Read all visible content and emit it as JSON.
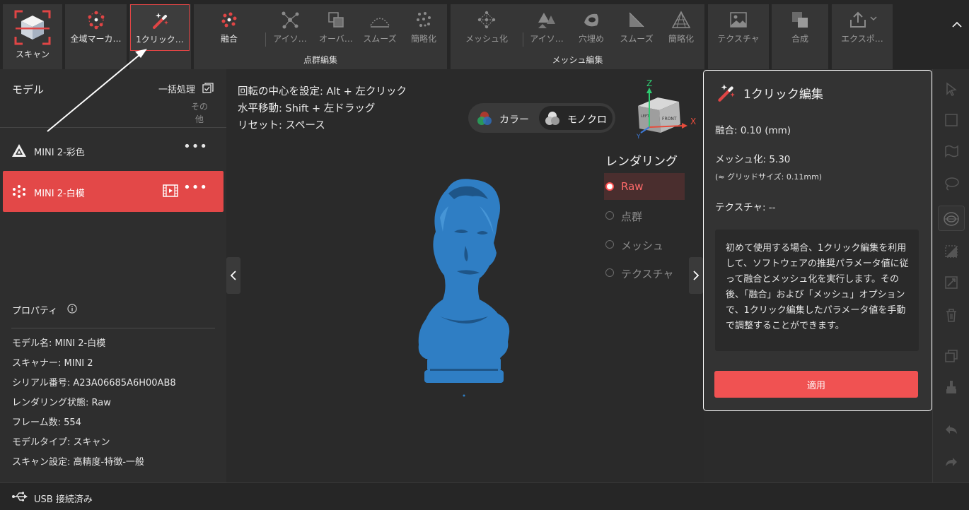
{
  "toolbar": {
    "scan": {
      "label": "スキャン"
    },
    "global_marker": {
      "label": "全域マーカ…"
    },
    "one_click": {
      "label": "1クリック…"
    },
    "point_group": {
      "title": "点群編集",
      "tools": [
        "融合",
        "アイソ…",
        "オーバ…",
        "スムーズ",
        "簡略化"
      ]
    },
    "mesh_group": {
      "title": "メッシュ編集",
      "tools": [
        "メッシュ化",
        "アイソ…",
        "穴埋め",
        "スムーズ",
        "簡略化"
      ]
    },
    "texture": {
      "label": "テクスチャ"
    },
    "merge": {
      "label": "合成"
    },
    "export": {
      "label": "エクスポ…"
    }
  },
  "left_panel": {
    "title": "モデル",
    "batch_label": "一括処理",
    "other_label": "その他",
    "models": [
      {
        "name": "MINI 2-彩色",
        "selected": false
      },
      {
        "name": "MINI 2-白模",
        "selected": true
      }
    ],
    "properties": {
      "title": "プロパティ",
      "items": [
        "モデル名:  MINI 2-白模",
        "スキャナー:  MINI 2",
        "シリアル番号:  A23A06685A6H00AB8",
        "レンダリング状態:  Raw",
        "フレーム数:  554",
        "モデルタイプ:  スキャン",
        "スキャン設定:  高精度-特徴-一般"
      ]
    }
  },
  "viewport": {
    "hints": [
      "回転の中心を設定: Alt + 左クリック",
      "水平移動: Shift + 左ドラッグ",
      "リセット: スペース"
    ],
    "color_toggle": {
      "color": "カラー",
      "mono": "モノクロ",
      "active": "mono"
    },
    "gizmo": {
      "z": "Z",
      "x": "X",
      "y": "Y",
      "front": "FRONT",
      "left": "LEFT"
    },
    "rendering": {
      "title": "レンダリング",
      "options": [
        "Raw",
        "点群",
        "メッシュ",
        "テクスチャ"
      ],
      "selected": "Raw"
    },
    "model_color": "#2f7ec4"
  },
  "one_click_panel": {
    "title": "1クリック編集",
    "fusion": "融合:   0.10 (mm)",
    "meshing": "メッシュ化:  5.30",
    "grid_size": "(≈ グリッドサイズ: 0.11mm)",
    "texture": "テクスチャ: --",
    "description": "初めて使用する場合、1クリック編集を利用して、ソフトウェアの推奨パラメータ値に従って融合とメッシュ化を実行します。その後、「融合」および「メッシュ」オプションで、1クリック編集したパラメータ値を手動で調整することができます。",
    "apply_label": "適用"
  },
  "status": {
    "usb": "USB 接続済み"
  },
  "colors": {
    "accent": "#e34848",
    "panel": "#333333",
    "background": "#2a2a2a"
  }
}
